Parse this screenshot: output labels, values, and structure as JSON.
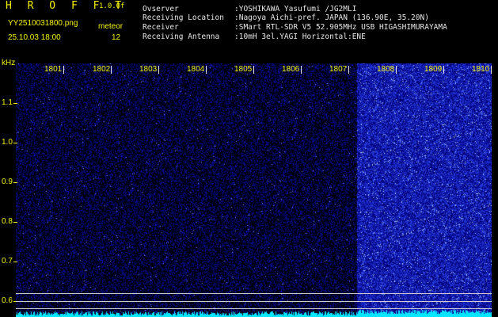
{
  "header": {
    "app_title": "H R O F F T",
    "version": "1.0.0f",
    "file_name": "YY2510031800.png",
    "date_time": "25.10.03 18:00",
    "meteor_label": "meteor",
    "meteor_count": "12"
  },
  "station_info": [
    {
      "label": "Ovserver",
      "value": ":YOSHIKAWA Yasufumi /JG2MLI"
    },
    {
      "label": "Receiving Location",
      "value": ":Nagoya Aichi-pref. JAPAN (136.90E, 35.20N)"
    },
    {
      "label": "Receiver",
      "value": ":SMart RTL-SDR V5 52.905MHz USB HIGASHIMURAYAMA"
    },
    {
      "label": "Receiving Antenna",
      "value": ":10mH 3el.YAGI Horizontal:ENE"
    }
  ],
  "axis": {
    "y_unit": "kHz",
    "y_ticks": [
      "1.1",
      "1.0",
      "0.9",
      "0.8",
      "0.7",
      "0.6"
    ],
    "time_labels": [
      "1801",
      "1802",
      "1803",
      "1804",
      "1805",
      "1806",
      "1807",
      "1808",
      "1809",
      "1810"
    ]
  },
  "colors": {
    "label_yellow": "#f2f200",
    "text_white": "#e6e6e6",
    "noise_blue": "#2020c8",
    "baseline_cyan": "#00e6ff"
  }
}
